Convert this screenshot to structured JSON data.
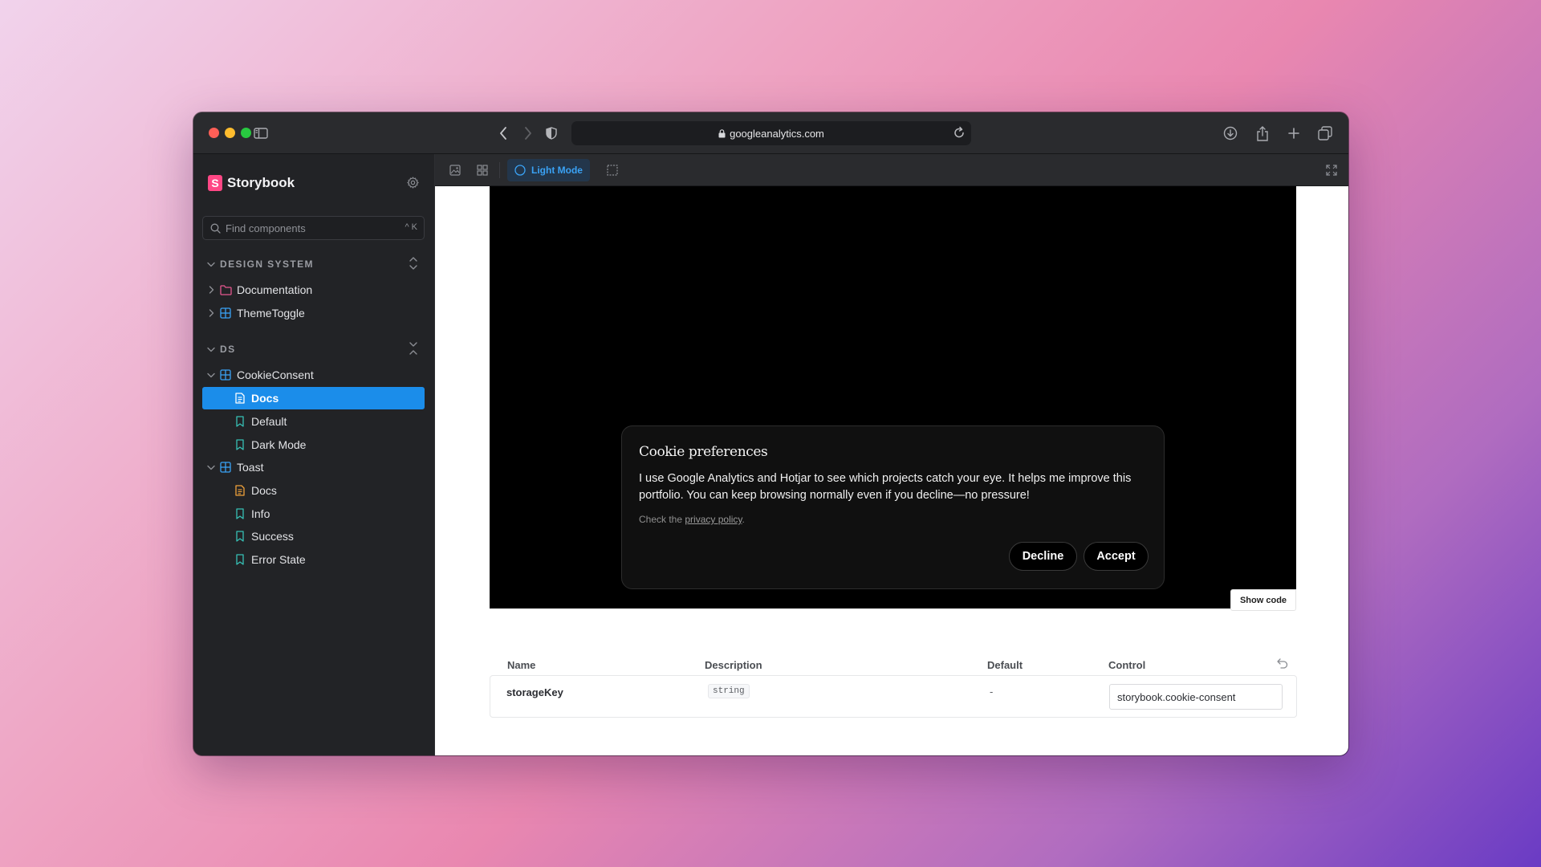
{
  "browser": {
    "url": "googleanalytics.com",
    "icons": [
      "sidebar-icon",
      "back-icon",
      "forward-icon",
      "shield-icon",
      "lock-icon",
      "reload-icon",
      "download-icon",
      "share-icon",
      "new-tab-icon",
      "tabs-icon"
    ]
  },
  "sidebar": {
    "brand": "Storybook",
    "search_placeholder": "Find components",
    "search_shortcut": "^ K",
    "sections": [
      {
        "title": "DESIGN SYSTEM",
        "items": [
          {
            "label": "Documentation",
            "icon": "folder-icon"
          },
          {
            "label": "ThemeToggle",
            "icon": "component-icon"
          }
        ]
      },
      {
        "title": "DS",
        "items": [
          {
            "label": "CookieConsent",
            "icon": "component-icon"
          },
          {
            "label": "Docs",
            "icon": "document-icon",
            "selected": true
          },
          {
            "label": "Default",
            "icon": "bookmark-icon"
          },
          {
            "label": "Dark Mode",
            "icon": "bookmark-icon"
          },
          {
            "label": "Toast",
            "icon": "component-icon"
          },
          {
            "label": "Docs",
            "icon": "document-icon"
          },
          {
            "label": "Info",
            "icon": "bookmark-icon"
          },
          {
            "label": "Success",
            "icon": "bookmark-icon"
          },
          {
            "label": "Error State",
            "icon": "bookmark-icon"
          }
        ]
      }
    ]
  },
  "toolbar": {
    "theme_label": "Light Mode"
  },
  "cookie": {
    "title": "Cookie preferences",
    "body": "I use Google Analytics and Hotjar to see which projects catch your eye. It helps me improve this portfolio. You can keep browsing normally even if you decline—no pressure!",
    "note_prefix": "Check the ",
    "note_link": "privacy policy",
    "note_suffix": ".",
    "decline": "Decline",
    "accept": "Accept"
  },
  "show_code": "Show code",
  "props": {
    "headers": [
      "Name",
      "Description",
      "Default",
      "Control"
    ],
    "rows": [
      {
        "name": "storageKey",
        "type": "string",
        "default": "-",
        "control": "storybook.cookie-consent"
      }
    ]
  },
  "colors": {
    "accent": "#1b8dea",
    "storybook_pink": "#ff4785",
    "component_blue": "#3aa2f5",
    "doc_orange": "#f0a23b",
    "story_teal": "#37c0b5",
    "folder_pink": "#e5578f"
  }
}
